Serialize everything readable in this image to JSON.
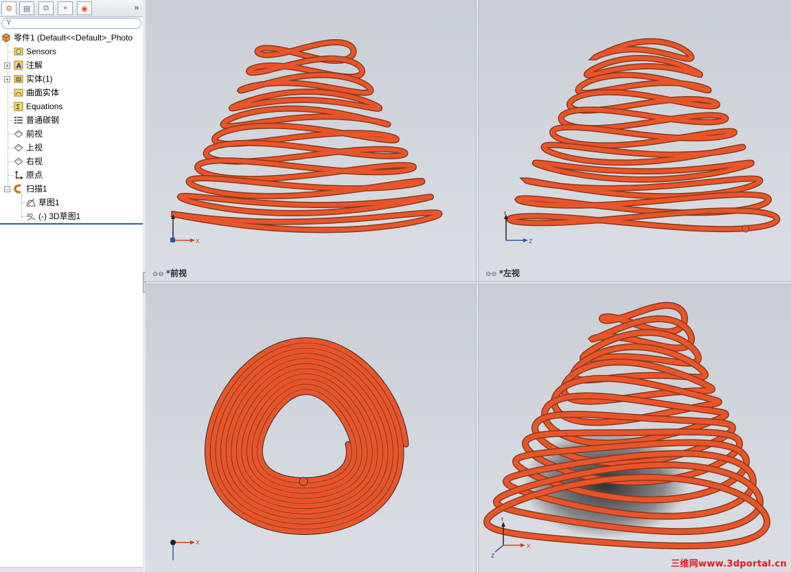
{
  "tabs": [
    {
      "name": "featuremanager-tab",
      "icon": "featuremanager-icon",
      "glyph": "⚙"
    },
    {
      "name": "propertymanager-tab",
      "icon": "propertymanager-icon",
      "glyph": "▤"
    },
    {
      "name": "configurationmanager-tab",
      "icon": "configurationmanager-icon",
      "glyph": "⧉"
    },
    {
      "name": "dimxpert-tab",
      "icon": "dimxpert-icon",
      "glyph": "⌖"
    },
    {
      "name": "display-manager-tab",
      "icon": "appearance-icon",
      "glyph": "◉"
    }
  ],
  "expand_glyph": "»",
  "filter_glyph": "Y",
  "tree": {
    "root": "零件1  (Default<<Default>_Photo",
    "items": [
      {
        "label": "Sensors",
        "icon": "sensors-icon"
      },
      {
        "label": "注解",
        "icon": "annotations-icon"
      },
      {
        "label": "实体(1)",
        "icon": "solid-bodies-icon"
      },
      {
        "label": "曲面实体",
        "icon": "surface-bodies-icon"
      },
      {
        "label": "Equations",
        "icon": "equations-icon"
      },
      {
        "label": "普通碳钢",
        "icon": "material-icon"
      },
      {
        "label": "前视",
        "icon": "plane-icon"
      },
      {
        "label": "上视",
        "icon": "plane-icon"
      },
      {
        "label": "右视",
        "icon": "plane-icon"
      },
      {
        "label": "原点",
        "icon": "origin-icon"
      },
      {
        "label": "扫描1",
        "icon": "sweep-icon"
      },
      {
        "label": "草图1",
        "icon": "sketch-icon"
      },
      {
        "label": "(-) 3D草图1",
        "icon": "sketch3d-icon"
      }
    ]
  },
  "viewports": {
    "front": {
      "label": "*前视"
    },
    "left": {
      "label": "*左视"
    }
  },
  "axes": {
    "x": "X",
    "y": "Y",
    "z": "Z"
  },
  "watermark": "三维网www.3dportal.cn",
  "colors": {
    "accent": "#e8552a",
    "tube_dark": "#8a3a1c",
    "viewport_top": "#c9ced6",
    "selection_bar": "#2f5fa0",
    "watermark": "#e0191b"
  }
}
